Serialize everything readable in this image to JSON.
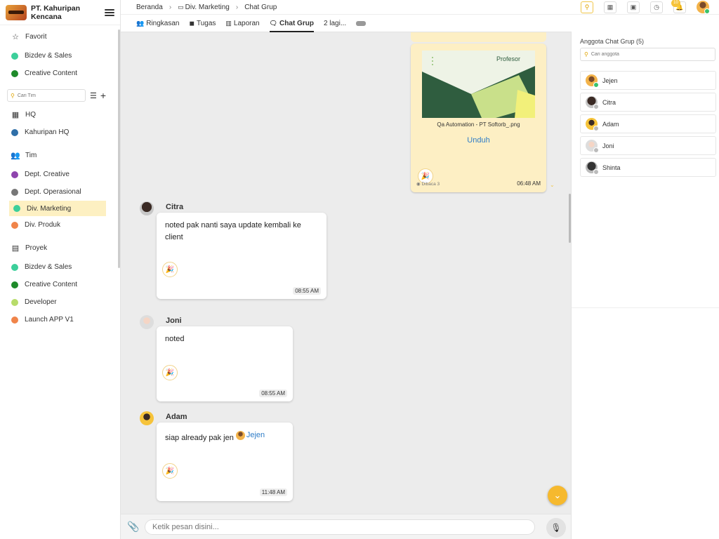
{
  "company": {
    "name": "PT. Kahuripan Kencana"
  },
  "sidebar": {
    "favorites_label": "Favorit",
    "favorites": [
      {
        "label": "Bizdev & Sales",
        "color": "#3ccf9a"
      },
      {
        "label": "Creative Content",
        "color": "#1e8a2a"
      }
    ],
    "search_placeholder": "Cari Tim",
    "hq_label": "HQ",
    "hq_items": [
      {
        "label": "Kahuripan HQ",
        "color": "#2f6fa8"
      }
    ],
    "team_label": "Tim",
    "teams": [
      {
        "label": "Dept. Creative",
        "color": "#8e44ad"
      },
      {
        "label": "Dept. Operasional",
        "color": "#777777"
      },
      {
        "label": "Div. Marketing",
        "color": "#3ccf9a",
        "active": true
      },
      {
        "label": "Div. Produk",
        "color": "#f0844a"
      }
    ],
    "project_label": "Proyek",
    "projects": [
      {
        "label": "Bizdev & Sales",
        "color": "#3ccf9a"
      },
      {
        "label": "Creative Content",
        "color": "#1e8a2a"
      },
      {
        "label": "Developer",
        "color": "#b7dc6a"
      },
      {
        "label": "Launch APP V1",
        "color": "#f0844a"
      }
    ]
  },
  "breadcrumb": [
    "Beranda",
    "Div. Marketing",
    "Chat Grup"
  ],
  "topbar": {
    "notif_count": "10"
  },
  "tabs": [
    {
      "label": "Ringkasan"
    },
    {
      "label": "Tugas"
    },
    {
      "label": "Laporan"
    },
    {
      "label": "Chat Grup",
      "active": true
    },
    {
      "label": "2 lagi..."
    }
  ],
  "image_message": {
    "brand": "Profesor",
    "caption": "Qa Automation - PT Softorb_.png",
    "download_label": "Unduh",
    "read_label": "Dibaca 3",
    "time": "06:48 AM"
  },
  "messages": [
    {
      "name": "Citra",
      "text": "noted pak nanti saya update kembali ke client",
      "time": "08:55 AM"
    },
    {
      "name": "Joni",
      "text": "noted",
      "time": "08:55 AM"
    },
    {
      "name": "Adam",
      "text": "siap already pak jen",
      "mention": "Jejen",
      "time": "11:48 AM"
    }
  ],
  "input": {
    "placeholder": "Ketik pesan disini..."
  },
  "members_panel": {
    "title": "Anggota Chat Grup (5)",
    "search_placeholder": "Cari anggota",
    "members": [
      {
        "name": "Jejen",
        "online": true
      },
      {
        "name": "Citra",
        "online": false
      },
      {
        "name": "Adam",
        "online": false
      },
      {
        "name": "Joni",
        "online": false
      },
      {
        "name": "Shinta",
        "online": false
      }
    ]
  },
  "icons": {
    "menu": "hamburger-icon",
    "favorite": "star-icon",
    "hq": "building-icon",
    "team": "people-icon",
    "project": "clipboard-icon",
    "attach": "paperclip-icon",
    "mic": "microphone-icon",
    "scroll_down": "chevron-double-down-icon",
    "reaction": "party-popper-icon"
  },
  "colors": {
    "accent": "#f6b92e",
    "link": "#2e7cc7",
    "active_nav": "#fdf0c2",
    "image_bubble": "#fdefc4"
  }
}
